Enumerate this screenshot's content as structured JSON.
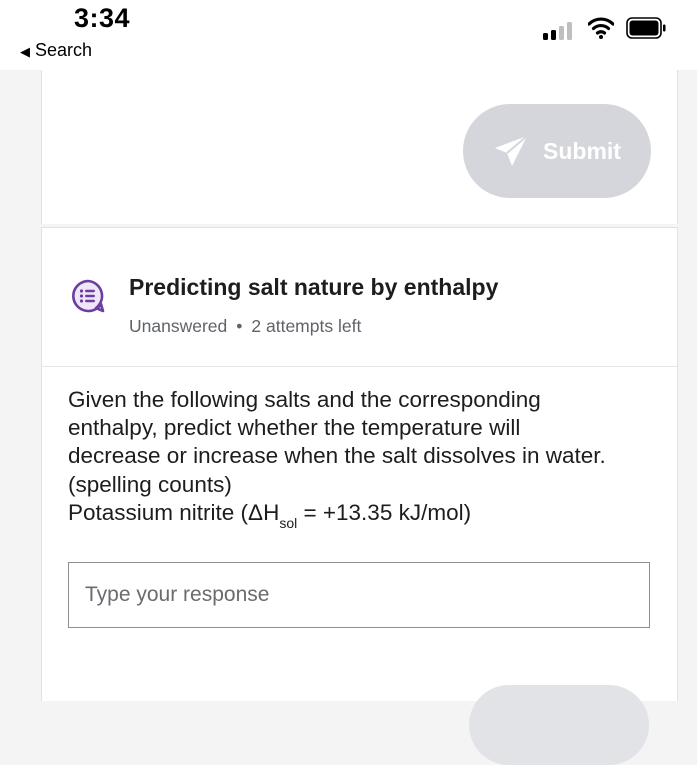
{
  "status_bar": {
    "time": "3:34",
    "back_label": "Search",
    "back_glyph": "◀",
    "icons": [
      "cellular-signal-icon",
      "wifi-icon",
      "battery-icon"
    ]
  },
  "submit": {
    "label": "Submit",
    "icon": "paper-plane-icon",
    "state": "disabled"
  },
  "question": {
    "icon": "chat-list-icon",
    "title": "Predicting salt nature by enthalpy",
    "status": "Unanswered",
    "separator": "•",
    "attempts": "2 attempts left",
    "prompt_lines": [
      "Given the following salts and the corresponding",
      "enthalpy, predict whether the temperature will",
      "decrease or increase when the salt dissolves in water.",
      "(spelling counts)"
    ],
    "salt_prefix": "Potassium nitrite (ΔH",
    "salt_subscript": "sol",
    "salt_suffix": " = +13.35 kJ/mol)"
  },
  "response": {
    "placeholder": "Type your response",
    "value": ""
  },
  "colors": {
    "accent_purple": "#6b3fa0",
    "button_disabled": "#d4d6db",
    "text": "#1d1d1f",
    "muted": "#5f6368"
  }
}
